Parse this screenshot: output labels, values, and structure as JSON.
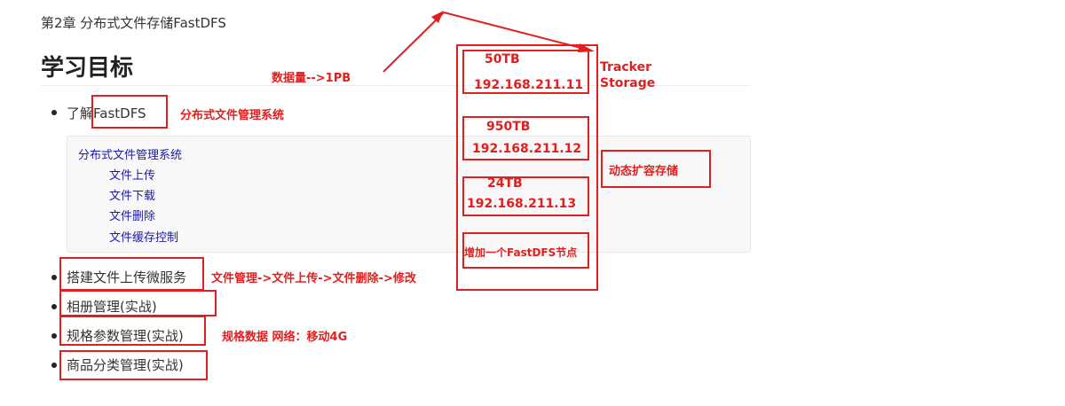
{
  "chapter": "第2章 分布式文件存储FastDFS",
  "heading": "学习目标",
  "bullets": [
    "了解FastDFS",
    "搭建文件上传微服务",
    "相册管理(实战)",
    "规格参数管理(实战)",
    "商品分类管理(实战)"
  ],
  "code": {
    "title": "分布式文件管理系统",
    "items": [
      "文件上传",
      "文件下载",
      "文件删除",
      "文件缓存控制"
    ]
  },
  "annotations": {
    "fastdfs_desc": "分布式文件管理系统",
    "data_volume": "数据量-->1PB",
    "tracker": "Tracker",
    "storage": "Storage",
    "dynamic_expand": "动态扩容存储",
    "file_flow": "文件管理->文件上传->文件删除->修改",
    "spec_data": "规格数据   网络：移动4G"
  },
  "storage_nodes": [
    {
      "size": "50TB",
      "ip": "192.168.211.11"
    },
    {
      "size": "950TB",
      "ip": "192.168.211.12"
    },
    {
      "size": "24TB",
      "ip": "192.168.211.13"
    }
  ],
  "add_node": "增加一个FastDFS节点",
  "accent_color": "#e02020"
}
